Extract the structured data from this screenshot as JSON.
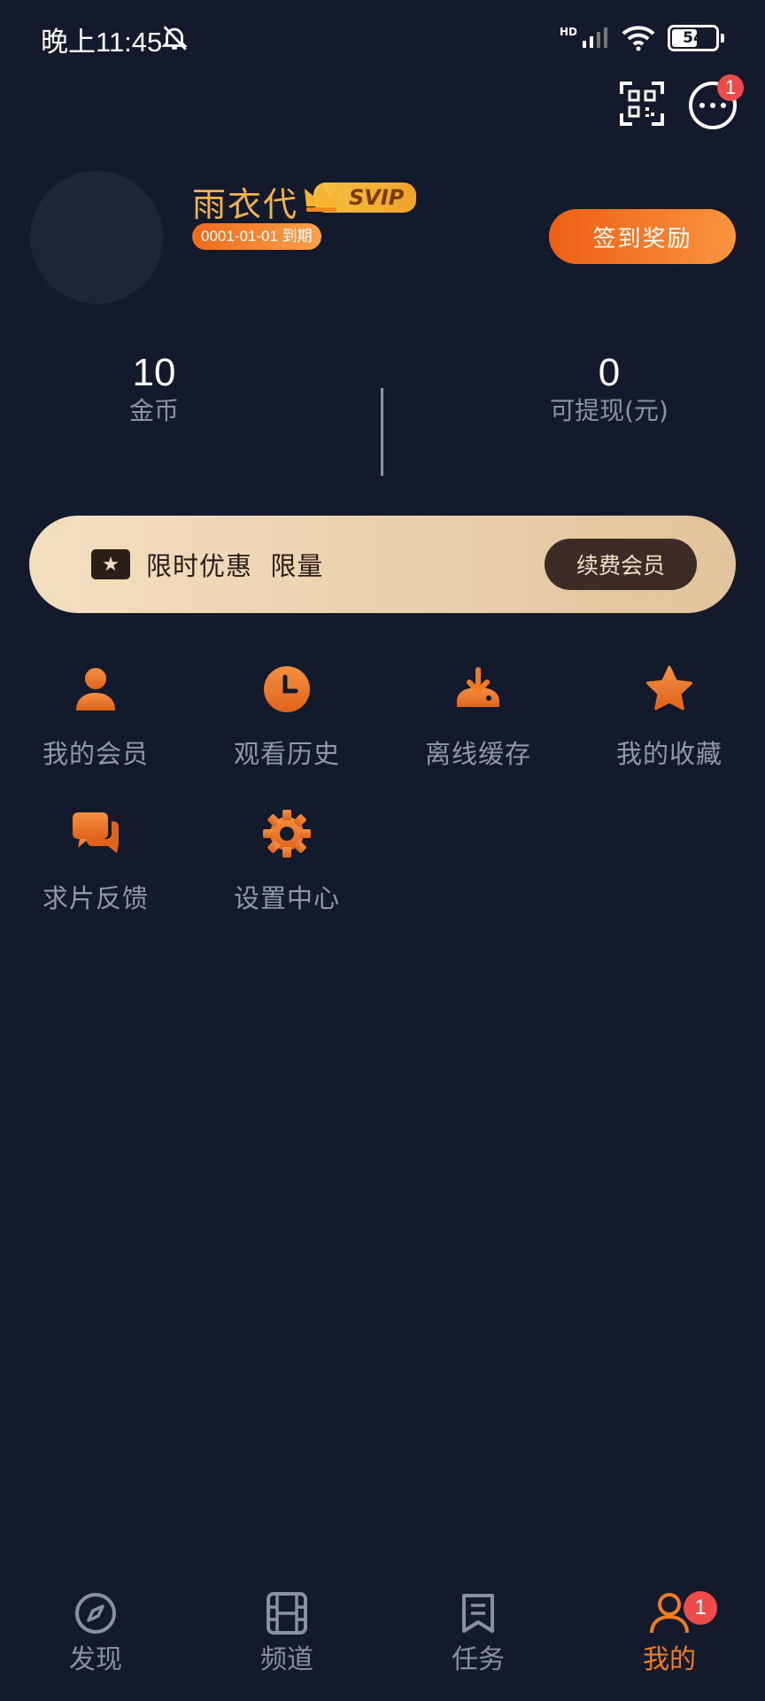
{
  "status_bar": {
    "time": "晚上11:45",
    "network": "HD",
    "battery": "54"
  },
  "profile": {
    "username": "雨衣代",
    "vip_label": "SVIP",
    "expire": "0001-01-01 到期",
    "checkin_label": "签到奖励"
  },
  "message_badge": "1",
  "stats": [
    {
      "value": "10",
      "label": "金币"
    },
    {
      "value": "0",
      "label": "可提现(元)"
    }
  ],
  "promo": {
    "text": "限时优惠  限量",
    "button": "续费会员"
  },
  "menu": [
    {
      "label": "我的会员",
      "icon": "member-icon"
    },
    {
      "label": "观看历史",
      "icon": "clock-icon"
    },
    {
      "label": "离线缓存",
      "icon": "download-icon"
    },
    {
      "label": "我的收藏",
      "icon": "star-icon"
    },
    {
      "label": "求片反馈",
      "icon": "chat-icon"
    },
    {
      "label": "设置中心",
      "icon": "gear-icon"
    }
  ],
  "bottom_nav": [
    {
      "label": "发现",
      "icon": "compass-icon"
    },
    {
      "label": "频道",
      "icon": "film-icon"
    },
    {
      "label": "任务",
      "icon": "task-icon"
    },
    {
      "label": "我的",
      "icon": "person-icon",
      "active": true
    }
  ],
  "nav_badge": "1",
  "colors": {
    "background": "#131a2b",
    "accent": "#f07c22",
    "gold": "#f3b24c"
  }
}
